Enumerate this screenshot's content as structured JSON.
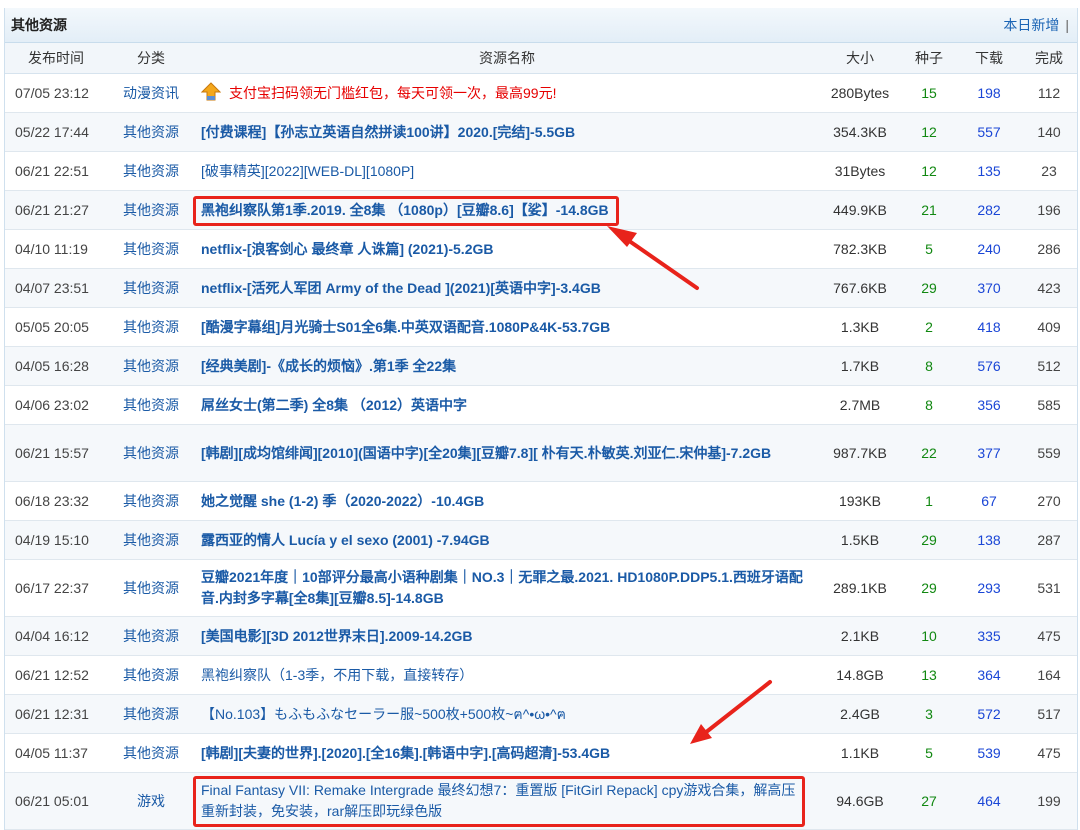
{
  "panel": {
    "title": "其他资源",
    "today_new": "本日新增",
    "separator": "|"
  },
  "columns": [
    "发布时间",
    "分类",
    "资源名称",
    "大小",
    "种子",
    "下载",
    "完成"
  ],
  "rows": [
    {
      "time": "07/05 23:12",
      "category": "动漫资讯",
      "name": "支付宝扫码领无门槛红包，每天可领一次，最高99元!",
      "size": "280Bytes",
      "seeds": "15",
      "downloads": "198",
      "completed": "112",
      "style": "ad",
      "icon": "arrow-up-icon"
    },
    {
      "time": "05/22 17:44",
      "category": "其他资源",
      "name": "[付费课程]【孙志立英语自然拼读100讲】2020.[完结]-5.5GB",
      "size": "354.3KB",
      "seeds": "12",
      "downloads": "557",
      "completed": "140",
      "style": "bold"
    },
    {
      "time": "06/21 22:51",
      "category": "其他资源",
      "name": "[破事精英][2022][WEB-DL][1080P]",
      "size": "31Bytes",
      "seeds": "12",
      "downloads": "135",
      "completed": "23",
      "style": "normal"
    },
    {
      "time": "06/21 21:27",
      "category": "其他资源",
      "name": "黑袍纠察队第1季.2019. 全8集 （1080p）[豆瓣8.6]【娑】-14.8GB",
      "size": "449.9KB",
      "seeds": "21",
      "downloads": "282",
      "completed": "196",
      "style": "bold",
      "highlight": true
    },
    {
      "time": "04/10 11:19",
      "category": "其他资源",
      "name": "netflix-[浪客剑心 最终章 人诛篇] (2021)-5.2GB",
      "size": "782.3KB",
      "seeds": "5",
      "downloads": "240",
      "completed": "286",
      "style": "bold"
    },
    {
      "time": "04/07 23:51",
      "category": "其他资源",
      "name": "netflix-[活死人军团 Army of the Dead ](2021)[英语中字]-3.4GB",
      "size": "767.6KB",
      "seeds": "29",
      "downloads": "370",
      "completed": "423",
      "style": "bold"
    },
    {
      "time": "05/05 20:05",
      "category": "其他资源",
      "name": "[酷漫字幕组]月光骑士S01全6集.中英双语配音.1080P&4K-53.7GB",
      "size": "1.3KB",
      "seeds": "2",
      "downloads": "418",
      "completed": "409",
      "style": "bold"
    },
    {
      "time": "04/05 16:28",
      "category": "其他资源",
      "name": "[经典美剧]-《成长的烦恼》.第1季 全22集",
      "size": "1.7KB",
      "seeds": "8",
      "downloads": "576",
      "completed": "512",
      "style": "bold"
    },
    {
      "time": "04/06 23:02",
      "category": "其他资源",
      "name": "屌丝女士(第二季) 全8集 （2012）英语中字",
      "size": "2.7MB",
      "seeds": "8",
      "downloads": "356",
      "completed": "585",
      "style": "bold"
    },
    {
      "time": "06/21 15:57",
      "category": "其他资源",
      "name": "[韩剧][成均馆绯闻][2010](国语中字)[全20集][豆瓣7.8][ 朴有天.朴敏英.刘亚仁.宋仲基]-7.2GB",
      "size": "987.7KB",
      "seeds": "22",
      "downloads": "377",
      "completed": "559",
      "style": "bold",
      "tall": true
    },
    {
      "time": "06/18 23:32",
      "category": "其他资源",
      "name": "她之觉醒 she (1-2) 季（2020-2022）-10.4GB",
      "size": "193KB",
      "seeds": "1",
      "downloads": "67",
      "completed": "270",
      "style": "bold"
    },
    {
      "time": "04/19 15:10",
      "category": "其他资源",
      "name": "露西亚的情人 Lucía y el sexo (2001) -7.94GB",
      "size": "1.5KB",
      "seeds": "29",
      "downloads": "138",
      "completed": "287",
      "style": "bold"
    },
    {
      "time": "06/17 22:37",
      "category": "其他资源",
      "name": "豆瓣2021年度｜10部评分最高小语种剧集｜NO.3｜无罪之最.2021. HD1080P.DDP5.1.西班牙语配音.内封多字幕[全8集][豆瓣8.5]-14.8GB",
      "size": "289.1KB",
      "seeds": "29",
      "downloads": "293",
      "completed": "531",
      "style": "bold",
      "tall": true
    },
    {
      "time": "04/04 16:12",
      "category": "其他资源",
      "name": "[美国电影][3D 2012世界末日].2009-14.2GB",
      "size": "2.1KB",
      "seeds": "10",
      "downloads": "335",
      "completed": "475",
      "style": "bold"
    },
    {
      "time": "06/21 12:52",
      "category": "其他资源",
      "name": "黑袍纠察队（1-3季，不用下载，直接转存）",
      "size": "14.8GB",
      "seeds": "13",
      "downloads": "364",
      "completed": "164",
      "style": "normal"
    },
    {
      "time": "06/21 12:31",
      "category": "其他资源",
      "name": "【No.103】もふもふなセーラー服~500枚+500枚~ฅ^•ω•^ฅ",
      "size": "2.4GB",
      "seeds": "3",
      "downloads": "572",
      "completed": "517",
      "style": "normal"
    },
    {
      "time": "04/05 11:37",
      "category": "其他资源",
      "name": "[韩剧][夫妻的世界].[2020].[全16集].[韩语中字].[高码超清]-53.4GB",
      "size": "1.1KB",
      "seeds": "5",
      "downloads": "539",
      "completed": "475",
      "style": "bold"
    },
    {
      "time": "06/21 05:01",
      "category": "游戏",
      "name": "Final Fantasy VII: Remake Intergrade 最终幻想7：重置版 [FitGirl Repack] cpy游戏合集，解高压重新封装，免安装，rar解压即玩绿色版",
      "size": "94.6GB",
      "seeds": "27",
      "downloads": "464",
      "completed": "199",
      "style": "normal",
      "tall": true,
      "highlight": true
    }
  ],
  "colors": {
    "link": "#1a5aa6",
    "ad": "#e60000",
    "seeds": "#118811",
    "downloads": "#1a46d6",
    "annotation": "#e8231b"
  }
}
